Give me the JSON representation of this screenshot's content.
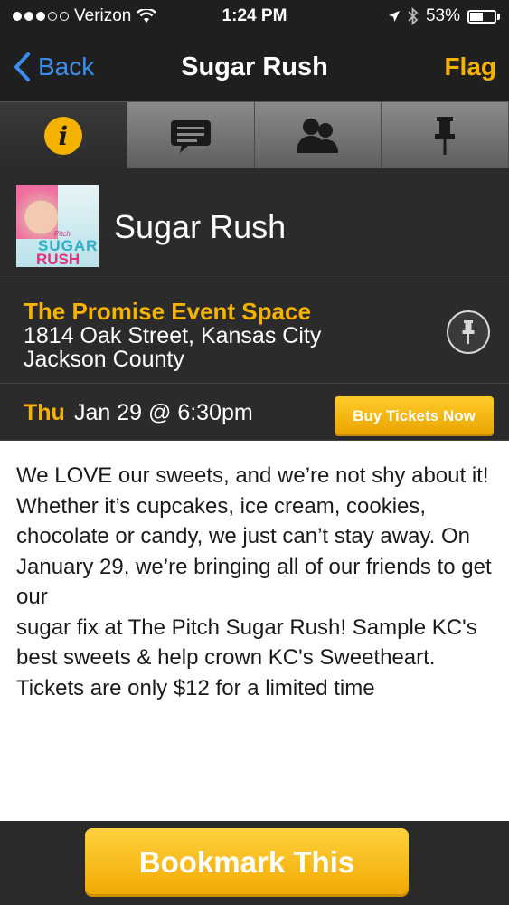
{
  "status_bar": {
    "carrier": "Verizon",
    "time": "1:24 PM",
    "battery": "53%",
    "battery_level": 0.53,
    "signal_bars_filled": 3,
    "signal_bars_total": 5
  },
  "nav": {
    "back_label": "Back",
    "title": "Sugar Rush",
    "flag_label": "Flag"
  },
  "tabs": [
    {
      "icon": "info-icon",
      "active": true
    },
    {
      "icon": "chat-icon",
      "active": false
    },
    {
      "icon": "people-icon",
      "active": false
    },
    {
      "icon": "pushpin-icon",
      "active": false
    }
  ],
  "event": {
    "thumbnail_text": {
      "pitch": "Pitch",
      "sugar": "SUGAR",
      "rush": "RUSH"
    },
    "name": "Sugar Rush",
    "venue_name": "The Promise Event Space",
    "venue_address": "1814 Oak Street, Kansas City",
    "venue_county": "Jackson County",
    "date_day": "Thu",
    "date_time": "Jan 29 @ 6:30pm",
    "buy_label": "Buy Tickets Now"
  },
  "description": {
    "lines": [
      "We LOVE our sweets, and we’re not shy about it! Whether it’s cupcakes, ice cream, cookies,",
      "chocolate or candy, we just can’t stay away. On January 29, we’re bringing all of our friends to get our",
      "sugar fix at The Pitch Sugar Rush! Sample KC's best sweets & help crown KC's Sweetheart. Tickets are only $12 for a limited time"
    ]
  },
  "bottom": {
    "bookmark_label": "Bookmark This"
  },
  "colors": {
    "accent": "#f5b300",
    "link_blue": "#3a8ef0",
    "panel": "#2b2b2b",
    "background": "#1f1f1f"
  }
}
